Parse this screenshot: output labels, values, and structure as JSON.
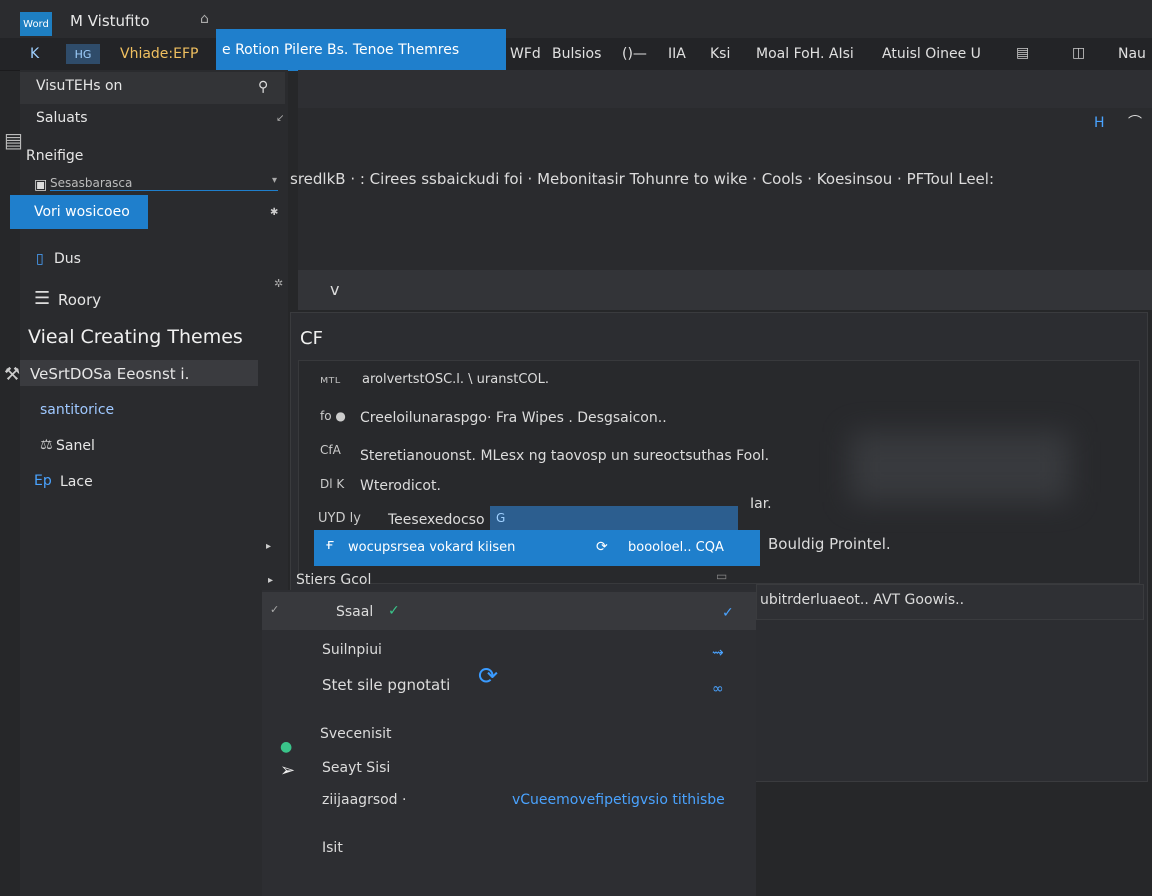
{
  "titlebar": {
    "app_badge": "Word",
    "label": "Vistufito"
  },
  "menubar": {
    "items": [
      "Vhiade:EFP",
      "WFd",
      "Bulsios",
      "()—",
      "IIA",
      "Ksi",
      "Moal FoH. AIsi",
      "Atuisl Oinee U",
      "Nau"
    ],
    "active_item": "e Rotion Pilere Bs. Tenoe Themres"
  },
  "sidebar": {
    "header": "VisuTEHs on",
    "items": [
      "Saluats",
      "Rneifige",
      "Sesasbarasca",
      "Vori wosicoeo",
      "Dus",
      "Roory",
      "Vieal Creating Themes",
      "VeSrtDOSa Eeosnst i.",
      "santitorice",
      "Sanel",
      "Lace"
    ]
  },
  "infopanel": {
    "line": "sredlkB · : Cirees   ssbaickudi   foi ·  Mebonitasir   Tohunre to wike · Cools · Koesinsou ·  PFToul Leel:"
  },
  "row": {
    "chevron": "v"
  },
  "cf_panel": {
    "title": "CF",
    "lines": [
      "arolvertstOSC.l. \\ uranstCOL.",
      "Creeloilunaraspgo·  Fra  Wipes . Desgsaicon..",
      "Steretianouonst.  MLesx ng taovosp un sureoctsuthas Fool.",
      "Wterodicot.",
      "Teesexedocso",
      "Iar.",
      "Bouldig Prointel."
    ],
    "selected": {
      "left": "wocupsrsea vokard kiisen",
      "right": "boooloel.. CQA"
    }
  },
  "dropdown": {
    "header": "Stiers Gcol",
    "items": [
      "Ssaal",
      "Suilnpiui",
      "Stet sile pgnotati",
      "Svecenisit",
      "Seayt Sisi",
      "ziijaagrsod ·",
      "Isit"
    ],
    "link": "vCueemovefipetigvsio tithisbe",
    "right_row": "ubitrderluaeot..  AVT Goowis.."
  }
}
